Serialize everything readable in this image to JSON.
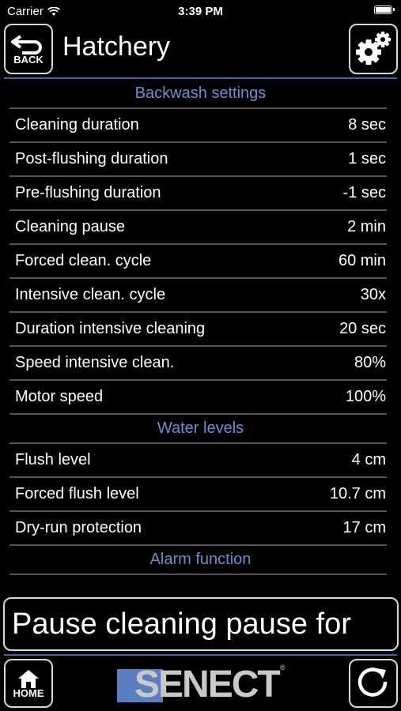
{
  "status_bar": {
    "carrier": "Carrier",
    "time": "3:39 PM"
  },
  "header": {
    "title": "Hatchery",
    "back_label": "BACK"
  },
  "sections": {
    "backwash": {
      "title": "Backwash settings",
      "rows": [
        {
          "label": "Cleaning duration",
          "value": "8 sec"
        },
        {
          "label": "Post-flushing duration",
          "value": "1 sec"
        },
        {
          "label": "Pre-flushing duration",
          "value": "-1 sec"
        },
        {
          "label": "Cleaning pause",
          "value": "2 min"
        },
        {
          "label": "Forced clean. cycle",
          "value": "60 min"
        },
        {
          "label": "Intensive clean. cycle",
          "value": "30x"
        },
        {
          "label": "Duration intensive cleaning",
          "value": "20 sec"
        },
        {
          "label": "Speed intensive clean.",
          "value": "80%"
        },
        {
          "label": "Motor speed",
          "value": "100%"
        }
      ]
    },
    "water": {
      "title": "Water levels",
      "rows": [
        {
          "label": "Flush level",
          "value": "4 cm"
        },
        {
          "label": "Forced flush level",
          "value": "10.7 cm"
        },
        {
          "label": "Dry-run protection",
          "value": "17 cm"
        }
      ]
    },
    "alarm": {
      "title": "Alarm function"
    }
  },
  "ticker": {
    "text": "Pause cleaning pause for"
  },
  "footer": {
    "home_label": "HOME",
    "logo_text": "SENECT",
    "logo_mark": "®"
  },
  "colors": {
    "accent": "#3f6aa8",
    "section_header": "#6b8fd1",
    "logo_blue": "#5b7ec1"
  }
}
